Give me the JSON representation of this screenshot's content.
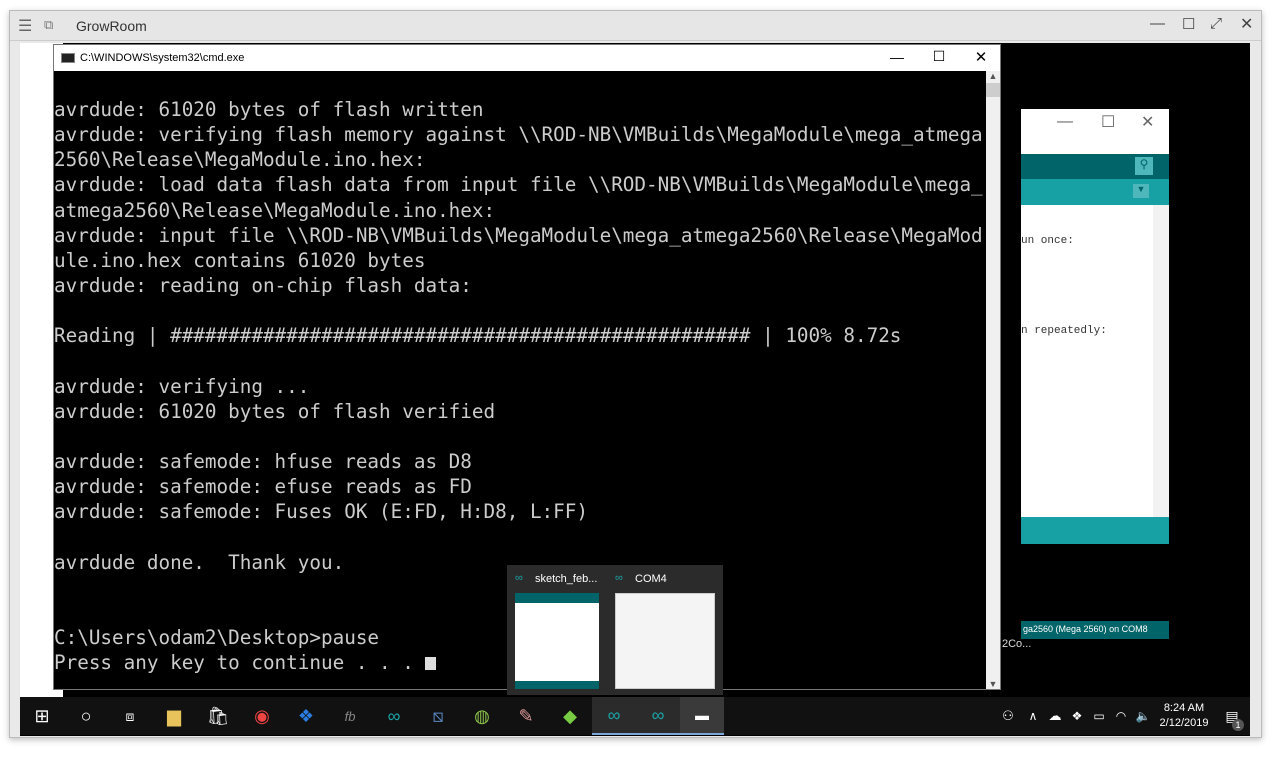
{
  "outer_window": {
    "title": "GrowRoom"
  },
  "cmd_window": {
    "title": "C:\\WINDOWS\\system32\\cmd.exe",
    "lines": [
      "avrdude: 61020 bytes of flash written",
      "avrdude: verifying flash memory against \\\\ROD-NB\\VMBuilds\\MegaModule\\mega_atmega",
      "2560\\Release\\MegaModule.ino.hex:",
      "avrdude: load data flash data from input file \\\\ROD-NB\\VMBuilds\\MegaModule\\mega_",
      "atmega2560\\Release\\MegaModule.ino.hex:",
      "avrdude: input file \\\\ROD-NB\\VMBuilds\\MegaModule\\mega_atmega2560\\Release\\MegaMod",
      "ule.ino.hex contains 61020 bytes",
      "avrdude: reading on-chip flash data:",
      "",
      "Reading | ################################################## | 100% 8.72s",
      "",
      "avrdude: verifying ...",
      "avrdude: 61020 bytes of flash verified",
      "",
      "avrdude: safemode: hfuse reads as D8",
      "avrdude: safemode: efuse reads as FD",
      "avrdude: safemode: Fuses OK (E:FD, H:D8, L:FF)",
      "",
      "avrdude done.  Thank you.",
      "",
      "",
      "C:\\Users\\odam2\\Desktop>pause",
      "Press any key to continue . . . "
    ]
  },
  "arduino_window": {
    "code_line1": "un once:",
    "code_line2": "n repeatedly:",
    "status": "ga2560 (Mega 2560) on COM8",
    "accent": "#00979c"
  },
  "desktop": {
    "icon_label": "2Co..."
  },
  "taskbar": {
    "time": "8:24 AM",
    "date": "2/12/2019",
    "notification_count": "1",
    "popup": [
      {
        "title": "sketch_feb..."
      },
      {
        "title": "COM4"
      }
    ]
  }
}
